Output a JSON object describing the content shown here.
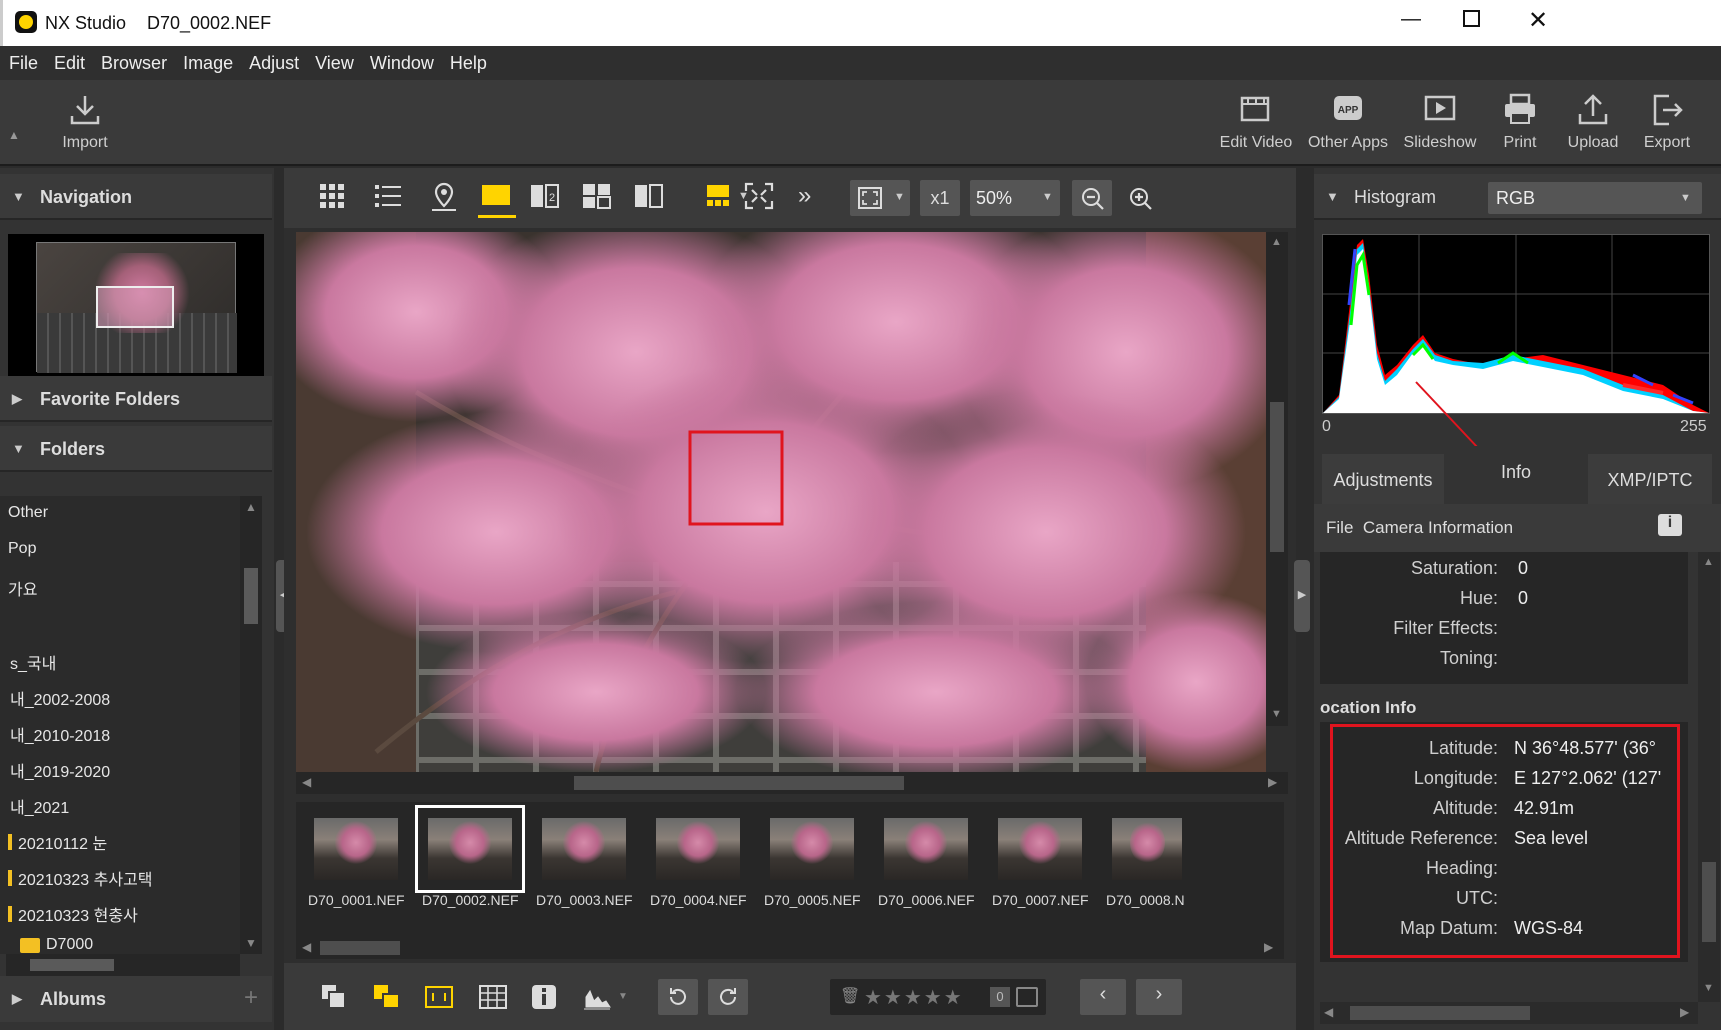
{
  "window": {
    "app_name": "NX Studio",
    "file_name": "D70_0002.NEF"
  },
  "menu": [
    "File",
    "Edit",
    "Browser",
    "Image",
    "Adjust",
    "View",
    "Window",
    "Help"
  ],
  "toolbar": {
    "import": "Import",
    "edit_video": "Edit Video",
    "other_apps": "Other Apps",
    "slideshow": "Slideshow",
    "print": "Print",
    "upload": "Upload",
    "export": "Export"
  },
  "left": {
    "navigation": "Navigation",
    "favorite_folders": "Favorite Folders",
    "folders": "Folders",
    "albums": "Albums",
    "folder_items": [
      "Other",
      "Pop",
      "가요",
      "s_국내",
      "내_2002-2008",
      "내_2010-2018",
      "내_2019-2020",
      "내_2021",
      "20210112 눈",
      "20210323 추사고택",
      "20210323 현충사",
      "D7000"
    ]
  },
  "center": {
    "zoom_multiplier": "x1",
    "zoom_percent": "50%",
    "filmstrip": [
      "D70_0001.NEF",
      "D70_0002.NEF",
      "D70_0003.NEF",
      "D70_0004.NEF",
      "D70_0005.NEF",
      "D70_0006.NEF",
      "D70_0007.NEF",
      "D70_0008.N"
    ],
    "selected_index": 1,
    "rating_count": "0"
  },
  "right": {
    "histogram": "Histogram",
    "channel": "RGB",
    "hist_min": "0",
    "hist_max": "255",
    "tabs": [
      "Adjustments",
      "Info",
      "XMP/IPTC"
    ],
    "active_tab": "Info",
    "info_header": "File  Camera Information",
    "camera_rows": [
      {
        "label": "Saturation:",
        "value": "0"
      },
      {
        "label": "Hue:",
        "value": "0"
      },
      {
        "label": "Filter Effects:",
        "value": ""
      },
      {
        "label": "Toning:",
        "value": ""
      }
    ],
    "location_title": "ocation Info",
    "location_rows": [
      {
        "label": "Latitude:",
        "value": "N 36°48.577' (36°"
      },
      {
        "label": "Longitude:",
        "value": "E 127°2.062' (127'"
      },
      {
        "label": "Altitude:",
        "value": "42.91m"
      },
      {
        "label": "Altitude Reference:",
        "value": "Sea level"
      },
      {
        "label": "Heading:",
        "value": ""
      },
      {
        "label": "UTC:",
        "value": ""
      },
      {
        "label": "Map Datum:",
        "value": "WGS-84"
      }
    ]
  },
  "colors": {
    "accent": "#ffd400",
    "highlight": "#e0141e",
    "panel": "#333333"
  }
}
